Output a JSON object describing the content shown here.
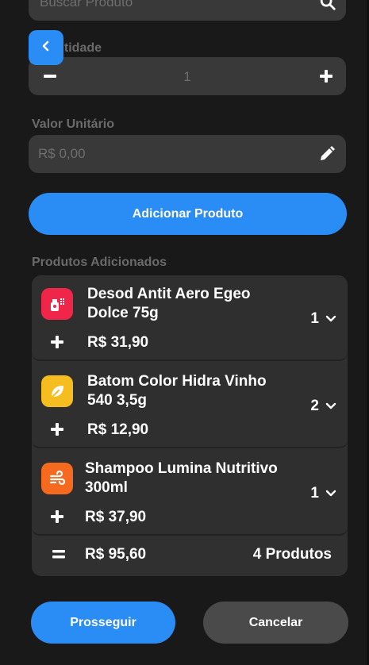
{
  "search": {
    "placeholder": "Buscar Produto",
    "icon": "search-icon"
  },
  "back": {
    "icon": "chevron-left-icon"
  },
  "quantity": {
    "label": "Quantidade",
    "value": "1"
  },
  "unit_price": {
    "label": "Valor Unitário",
    "placeholder": "R$ 0,00",
    "icon": "pencil-icon"
  },
  "add_button": {
    "label": "Adicionar Produto"
  },
  "added": {
    "label": "Produtos Adicionados",
    "items": [
      {
        "name": "Desod Antit Aero Egeo Dolce 75g",
        "qty": "1",
        "price": "R$ 31,90",
        "color": "#f0254a",
        "icon": "spray-icon"
      },
      {
        "name": "Batom Color Hidra Vinho 540 3,5g",
        "qty": "2",
        "price": "R$ 12,90",
        "color": "#f5bd1f",
        "icon": "leaf-icon"
      },
      {
        "name": "Shampoo Lumina Nutritivo 300ml",
        "qty": "1",
        "price": "R$ 37,90",
        "color": "#f56a1f",
        "icon": "wind-icon"
      }
    ],
    "total": {
      "value": "R$ 95,60",
      "count": "4 Produtos"
    }
  },
  "actions": {
    "proceed": "Prosseguir",
    "cancel": "Cancelar"
  },
  "colors": {
    "accent": "#2a8cf5",
    "background": "#191919",
    "field": "#393939"
  }
}
